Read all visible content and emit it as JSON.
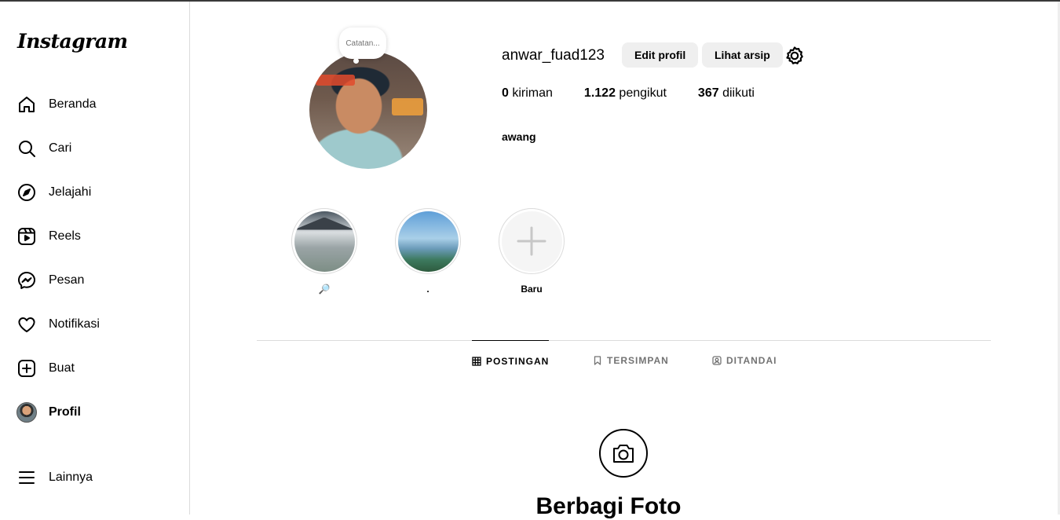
{
  "sidebar": {
    "logo": "Instagram",
    "items": [
      {
        "label": "Beranda",
        "icon": "home-icon"
      },
      {
        "label": "Cari",
        "icon": "search-icon"
      },
      {
        "label": "Jelajahi",
        "icon": "compass-icon"
      },
      {
        "label": "Reels",
        "icon": "reels-icon"
      },
      {
        "label": "Pesan",
        "icon": "messenger-icon"
      },
      {
        "label": "Notifikasi",
        "icon": "heart-icon"
      },
      {
        "label": "Buat",
        "icon": "plus-square-icon"
      },
      {
        "label": "Profil",
        "icon": "avatar"
      }
    ],
    "more_label": "Lainnya"
  },
  "profile": {
    "note_placeholder": "Catatan...",
    "username": "anwar_fuad123",
    "edit_button": "Edit profil",
    "archive_button": "Lihat arsip",
    "stats": {
      "posts_count": "0",
      "posts_label": "kiriman",
      "followers_count": "1.122",
      "followers_label": "pengikut",
      "following_count": "367",
      "following_label": "diikuti"
    },
    "full_name": "awang"
  },
  "highlights": [
    {
      "label": "🔎"
    },
    {
      "label": "."
    },
    {
      "label": "Baru"
    }
  ],
  "tabs": [
    {
      "label": "POSTINGAN",
      "icon": "grid-icon"
    },
    {
      "label": "TERSIMPAN",
      "icon": "bookmark-icon"
    },
    {
      "label": "DITANDAI",
      "icon": "tagged-icon"
    }
  ],
  "empty_state": {
    "title": "Berbagi Foto",
    "icon": "camera-icon"
  }
}
